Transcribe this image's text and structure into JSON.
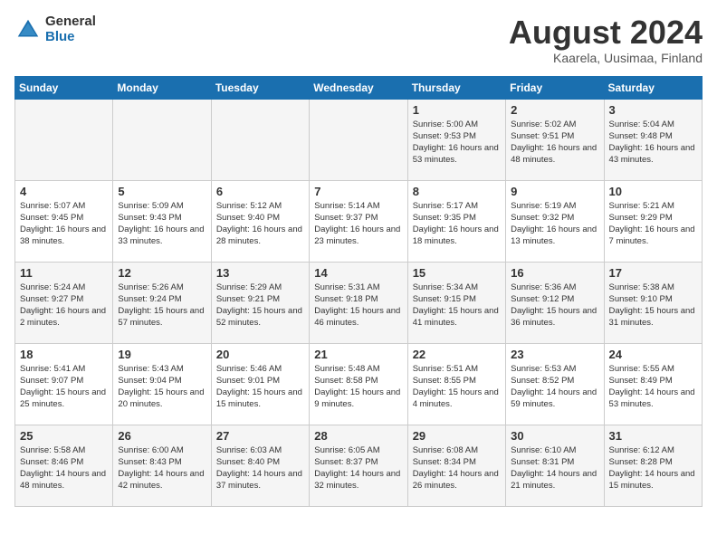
{
  "logo": {
    "general": "General",
    "blue": "Blue"
  },
  "title": "August 2024",
  "location": "Kaarela, Uusimaa, Finland",
  "days_of_week": [
    "Sunday",
    "Monday",
    "Tuesday",
    "Wednesday",
    "Thursday",
    "Friday",
    "Saturday"
  ],
  "weeks": [
    [
      {
        "num": "",
        "info": ""
      },
      {
        "num": "",
        "info": ""
      },
      {
        "num": "",
        "info": ""
      },
      {
        "num": "",
        "info": ""
      },
      {
        "num": "1",
        "info": "Sunrise: 5:00 AM\nSunset: 9:53 PM\nDaylight: 16 hours\nand 53 minutes."
      },
      {
        "num": "2",
        "info": "Sunrise: 5:02 AM\nSunset: 9:51 PM\nDaylight: 16 hours\nand 48 minutes."
      },
      {
        "num": "3",
        "info": "Sunrise: 5:04 AM\nSunset: 9:48 PM\nDaylight: 16 hours\nand 43 minutes."
      }
    ],
    [
      {
        "num": "4",
        "info": "Sunrise: 5:07 AM\nSunset: 9:45 PM\nDaylight: 16 hours\nand 38 minutes."
      },
      {
        "num": "5",
        "info": "Sunrise: 5:09 AM\nSunset: 9:43 PM\nDaylight: 16 hours\nand 33 minutes."
      },
      {
        "num": "6",
        "info": "Sunrise: 5:12 AM\nSunset: 9:40 PM\nDaylight: 16 hours\nand 28 minutes."
      },
      {
        "num": "7",
        "info": "Sunrise: 5:14 AM\nSunset: 9:37 PM\nDaylight: 16 hours\nand 23 minutes."
      },
      {
        "num": "8",
        "info": "Sunrise: 5:17 AM\nSunset: 9:35 PM\nDaylight: 16 hours\nand 18 minutes."
      },
      {
        "num": "9",
        "info": "Sunrise: 5:19 AM\nSunset: 9:32 PM\nDaylight: 16 hours\nand 13 minutes."
      },
      {
        "num": "10",
        "info": "Sunrise: 5:21 AM\nSunset: 9:29 PM\nDaylight: 16 hours\nand 7 minutes."
      }
    ],
    [
      {
        "num": "11",
        "info": "Sunrise: 5:24 AM\nSunset: 9:27 PM\nDaylight: 16 hours\nand 2 minutes."
      },
      {
        "num": "12",
        "info": "Sunrise: 5:26 AM\nSunset: 9:24 PM\nDaylight: 15 hours\nand 57 minutes."
      },
      {
        "num": "13",
        "info": "Sunrise: 5:29 AM\nSunset: 9:21 PM\nDaylight: 15 hours\nand 52 minutes."
      },
      {
        "num": "14",
        "info": "Sunrise: 5:31 AM\nSunset: 9:18 PM\nDaylight: 15 hours\nand 46 minutes."
      },
      {
        "num": "15",
        "info": "Sunrise: 5:34 AM\nSunset: 9:15 PM\nDaylight: 15 hours\nand 41 minutes."
      },
      {
        "num": "16",
        "info": "Sunrise: 5:36 AM\nSunset: 9:12 PM\nDaylight: 15 hours\nand 36 minutes."
      },
      {
        "num": "17",
        "info": "Sunrise: 5:38 AM\nSunset: 9:10 PM\nDaylight: 15 hours\nand 31 minutes."
      }
    ],
    [
      {
        "num": "18",
        "info": "Sunrise: 5:41 AM\nSunset: 9:07 PM\nDaylight: 15 hours\nand 25 minutes."
      },
      {
        "num": "19",
        "info": "Sunrise: 5:43 AM\nSunset: 9:04 PM\nDaylight: 15 hours\nand 20 minutes."
      },
      {
        "num": "20",
        "info": "Sunrise: 5:46 AM\nSunset: 9:01 PM\nDaylight: 15 hours\nand 15 minutes."
      },
      {
        "num": "21",
        "info": "Sunrise: 5:48 AM\nSunset: 8:58 PM\nDaylight: 15 hours\nand 9 minutes."
      },
      {
        "num": "22",
        "info": "Sunrise: 5:51 AM\nSunset: 8:55 PM\nDaylight: 15 hours\nand 4 minutes."
      },
      {
        "num": "23",
        "info": "Sunrise: 5:53 AM\nSunset: 8:52 PM\nDaylight: 14 hours\nand 59 minutes."
      },
      {
        "num": "24",
        "info": "Sunrise: 5:55 AM\nSunset: 8:49 PM\nDaylight: 14 hours\nand 53 minutes."
      }
    ],
    [
      {
        "num": "25",
        "info": "Sunrise: 5:58 AM\nSunset: 8:46 PM\nDaylight: 14 hours\nand 48 minutes."
      },
      {
        "num": "26",
        "info": "Sunrise: 6:00 AM\nSunset: 8:43 PM\nDaylight: 14 hours\nand 42 minutes."
      },
      {
        "num": "27",
        "info": "Sunrise: 6:03 AM\nSunset: 8:40 PM\nDaylight: 14 hours\nand 37 minutes."
      },
      {
        "num": "28",
        "info": "Sunrise: 6:05 AM\nSunset: 8:37 PM\nDaylight: 14 hours\nand 32 minutes."
      },
      {
        "num": "29",
        "info": "Sunrise: 6:08 AM\nSunset: 8:34 PM\nDaylight: 14 hours\nand 26 minutes."
      },
      {
        "num": "30",
        "info": "Sunrise: 6:10 AM\nSunset: 8:31 PM\nDaylight: 14 hours\nand 21 minutes."
      },
      {
        "num": "31",
        "info": "Sunrise: 6:12 AM\nSunset: 8:28 PM\nDaylight: 14 hours\nand 15 minutes."
      }
    ]
  ]
}
